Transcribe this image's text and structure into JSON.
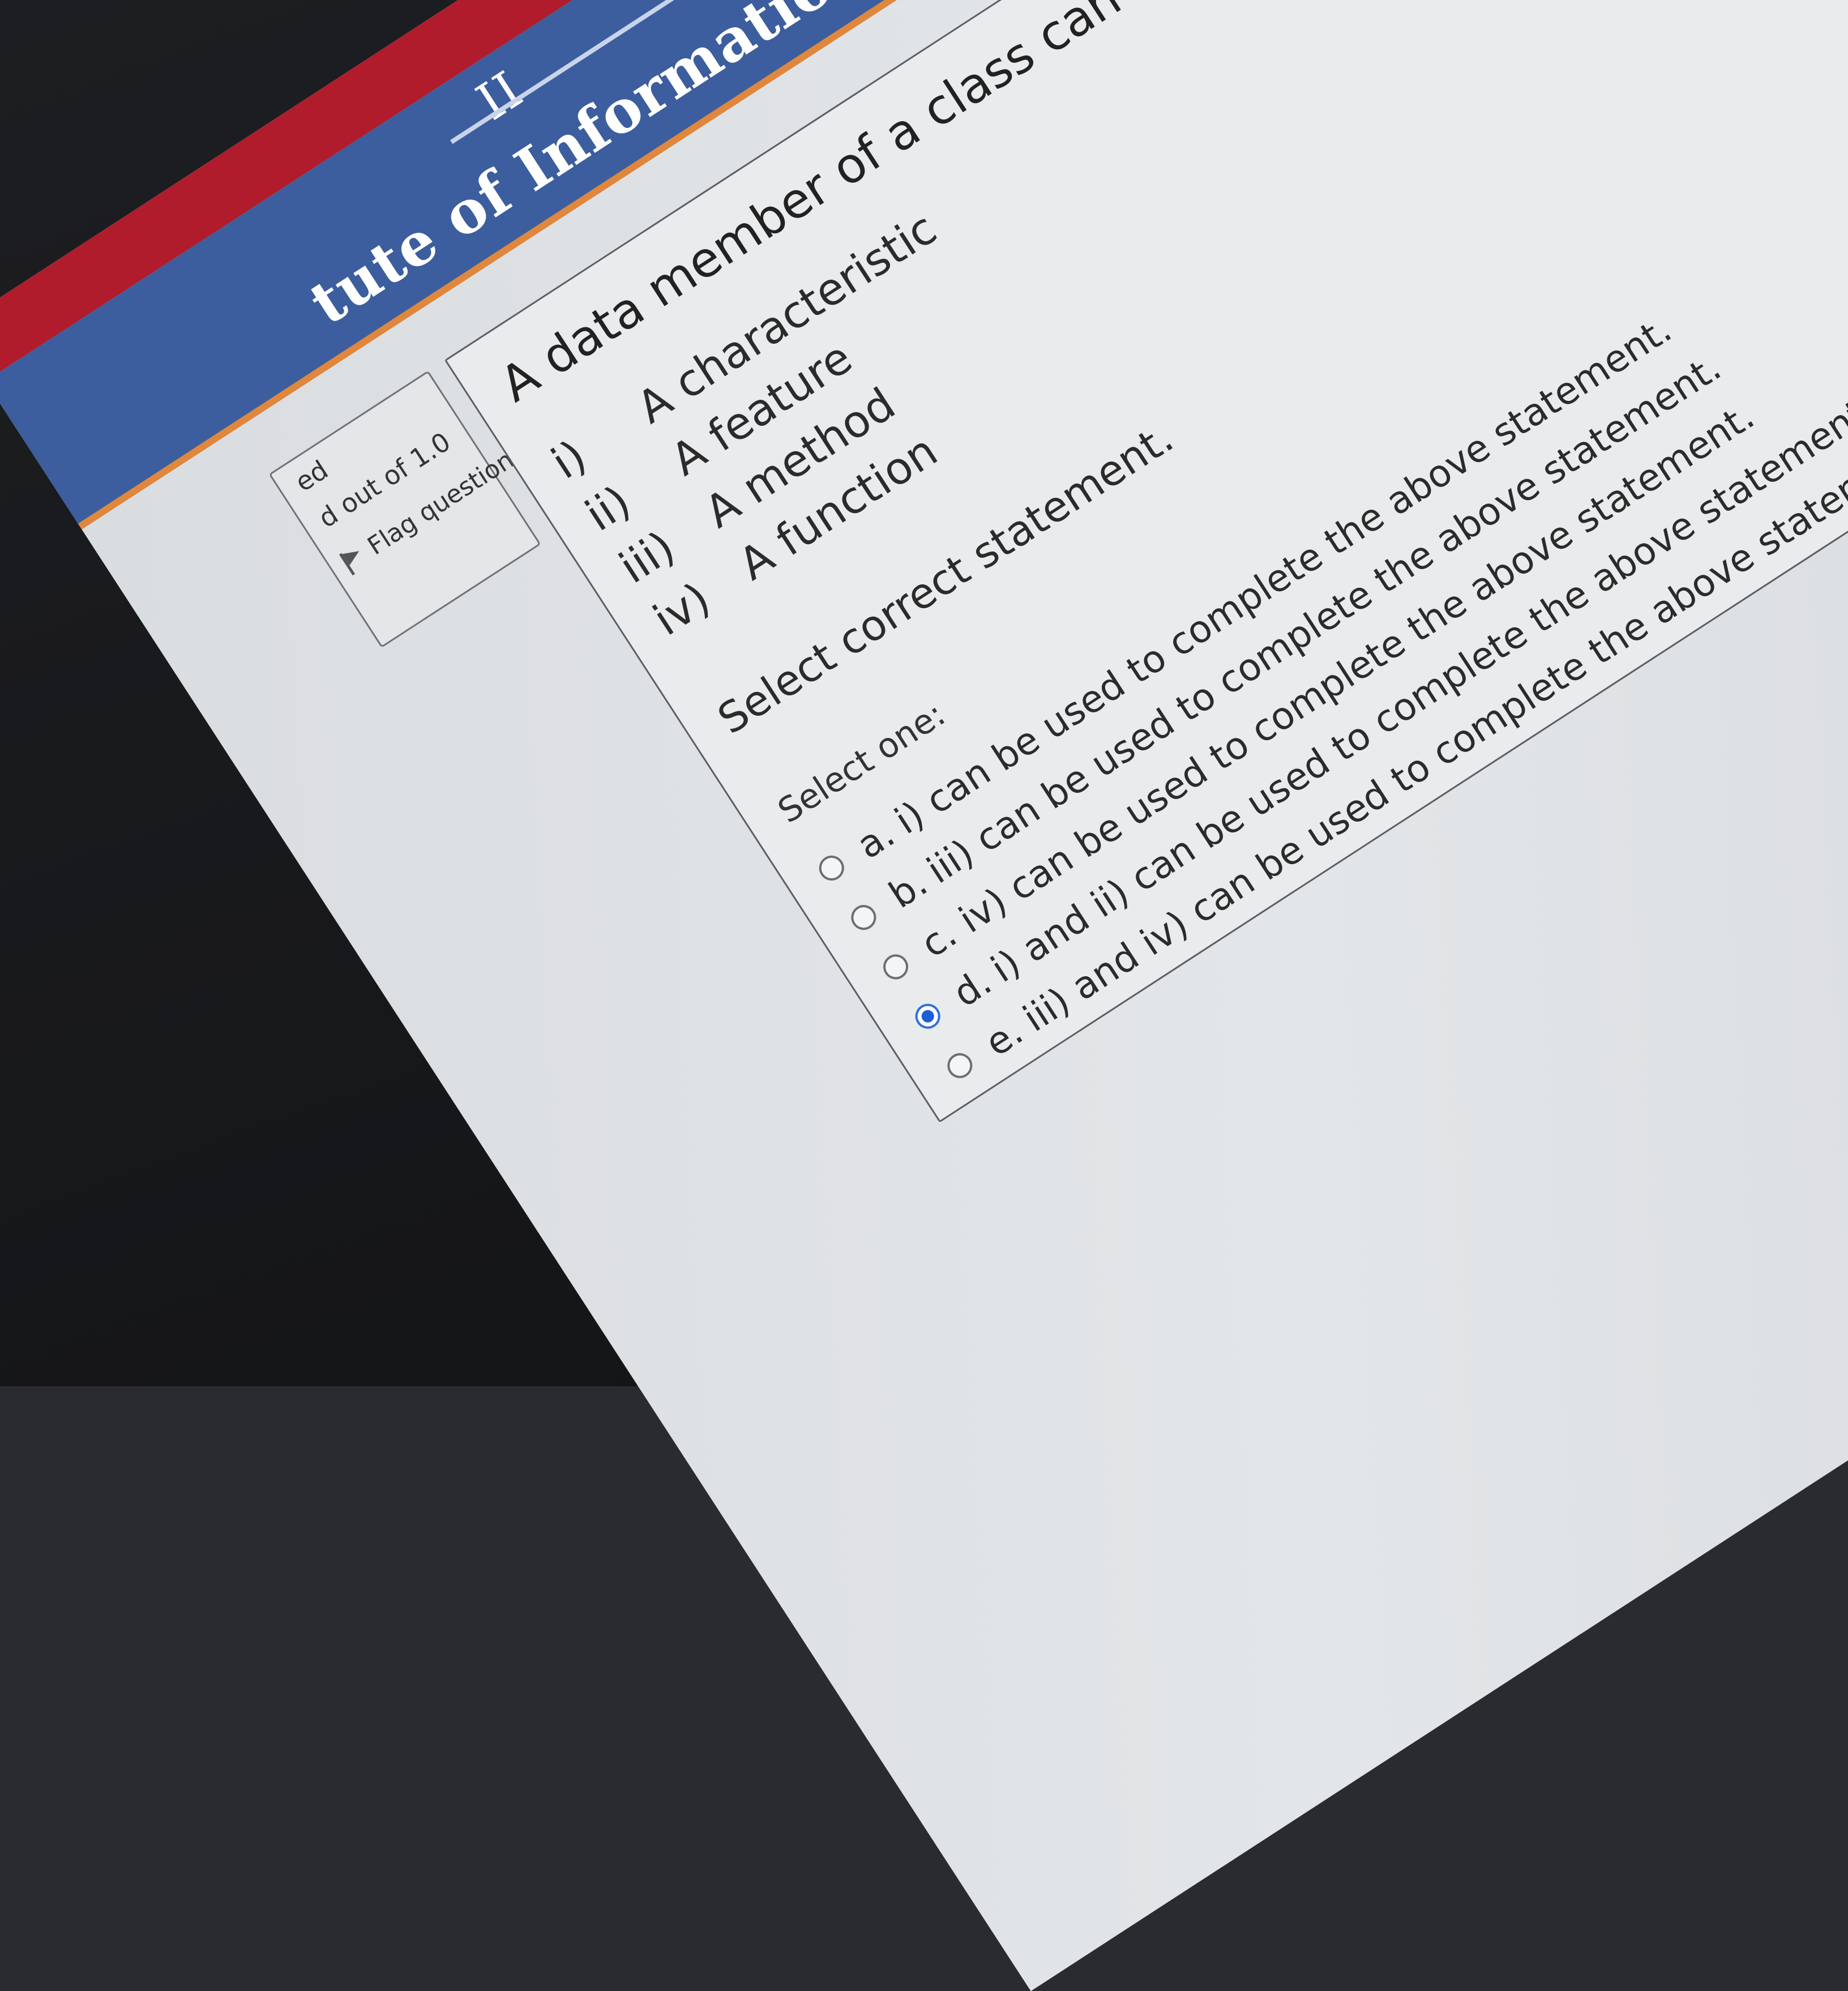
{
  "header": {
    "banner_title": "tute of Information Technology",
    "banner_fragment": "II"
  },
  "question_info": {
    "status": "ed",
    "mark": "d out of 1.0",
    "flag_label": "Flag question"
  },
  "question": {
    "stem": "A data member of a class can be referred as",
    "blank_suffix": ".",
    "items": [
      {
        "num": "i)",
        "text": "A characteristic"
      },
      {
        "num": "ii)",
        "text": "A feature"
      },
      {
        "num": "iii)",
        "text": "A method"
      },
      {
        "num": "iv)",
        "text": "A function"
      }
    ],
    "instruction": "Select correct statement.",
    "select_one": "Select one:",
    "answers": [
      {
        "letter": "a.",
        "text": "i) can be used to complete the above statement.",
        "checked": false
      },
      {
        "letter": "b.",
        "text": "iii) can be used to complete the above statement.",
        "checked": false
      },
      {
        "letter": "c.",
        "text": "iv) can be used to complete the above statement.",
        "checked": false
      },
      {
        "letter": "d.",
        "text": "i) and ii) can be used to complete the above statement.",
        "checked": true
      },
      {
        "letter": "e.",
        "text": "iii) and iv) can be used to complete the above statement.",
        "checked": false
      }
    ]
  },
  "colors": {
    "header_red": "#b01c2b",
    "banner_blue": "#3c5e9e",
    "accent_orange": "#e0873c",
    "radio_selected": "#1f5fd6"
  }
}
